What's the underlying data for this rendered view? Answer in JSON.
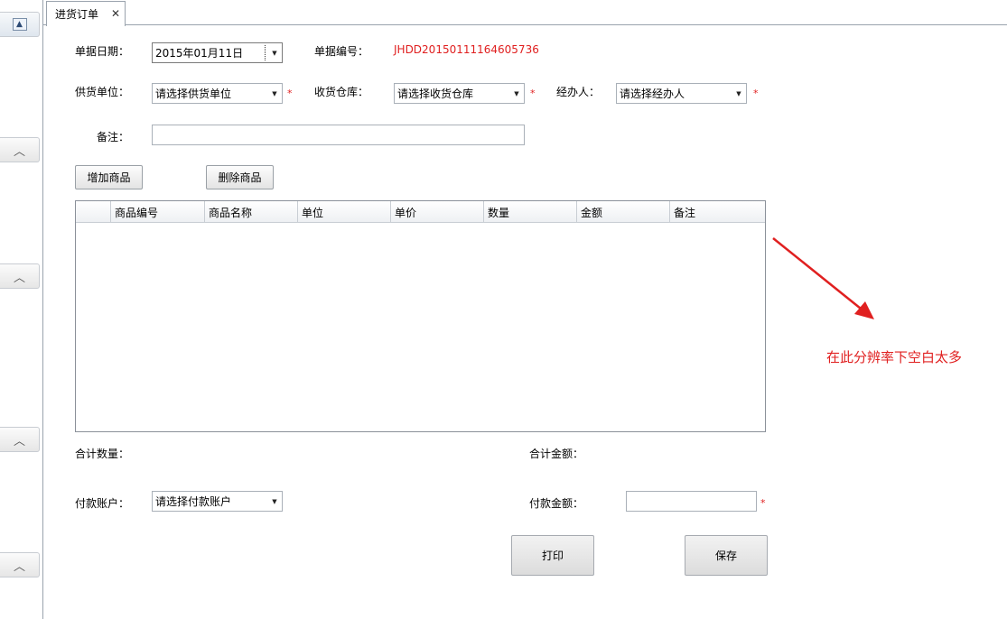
{
  "tab": {
    "title": "进货订单",
    "close": "✕"
  },
  "form": {
    "date_label": "单据日期：",
    "date_value": "2015年01月11日",
    "docno_label": "单据编号：",
    "docno_value": "JHDD20150111164605736",
    "supplier_label": "供货单位：",
    "supplier_value": "请选择供货单位",
    "warehouse_label": "收货仓库：",
    "warehouse_value": "请选择收货仓库",
    "handler_label": "经办人：",
    "handler_value": "请选择经办人",
    "remark_label": "备注：",
    "required_mark": "*"
  },
  "buttons": {
    "add": "增加商品",
    "delete": "删除商品",
    "print": "打印",
    "save": "保存"
  },
  "grid": {
    "columns": [
      "商品编号",
      "商品名称",
      "单位",
      "单价",
      "数量",
      "金额",
      "备注"
    ]
  },
  "summary": {
    "qty_label": "合计数量：",
    "amount_label": "合计金额：",
    "account_label": "付款账户：",
    "account_value": "请选择付款账户",
    "pay_amount_label": "付款金额："
  },
  "annotation": {
    "text": "在此分辨率下空白太多",
    "color": "#e02020"
  },
  "colors": {
    "accent_red": "#e02020",
    "border": "#9aa3ad"
  }
}
